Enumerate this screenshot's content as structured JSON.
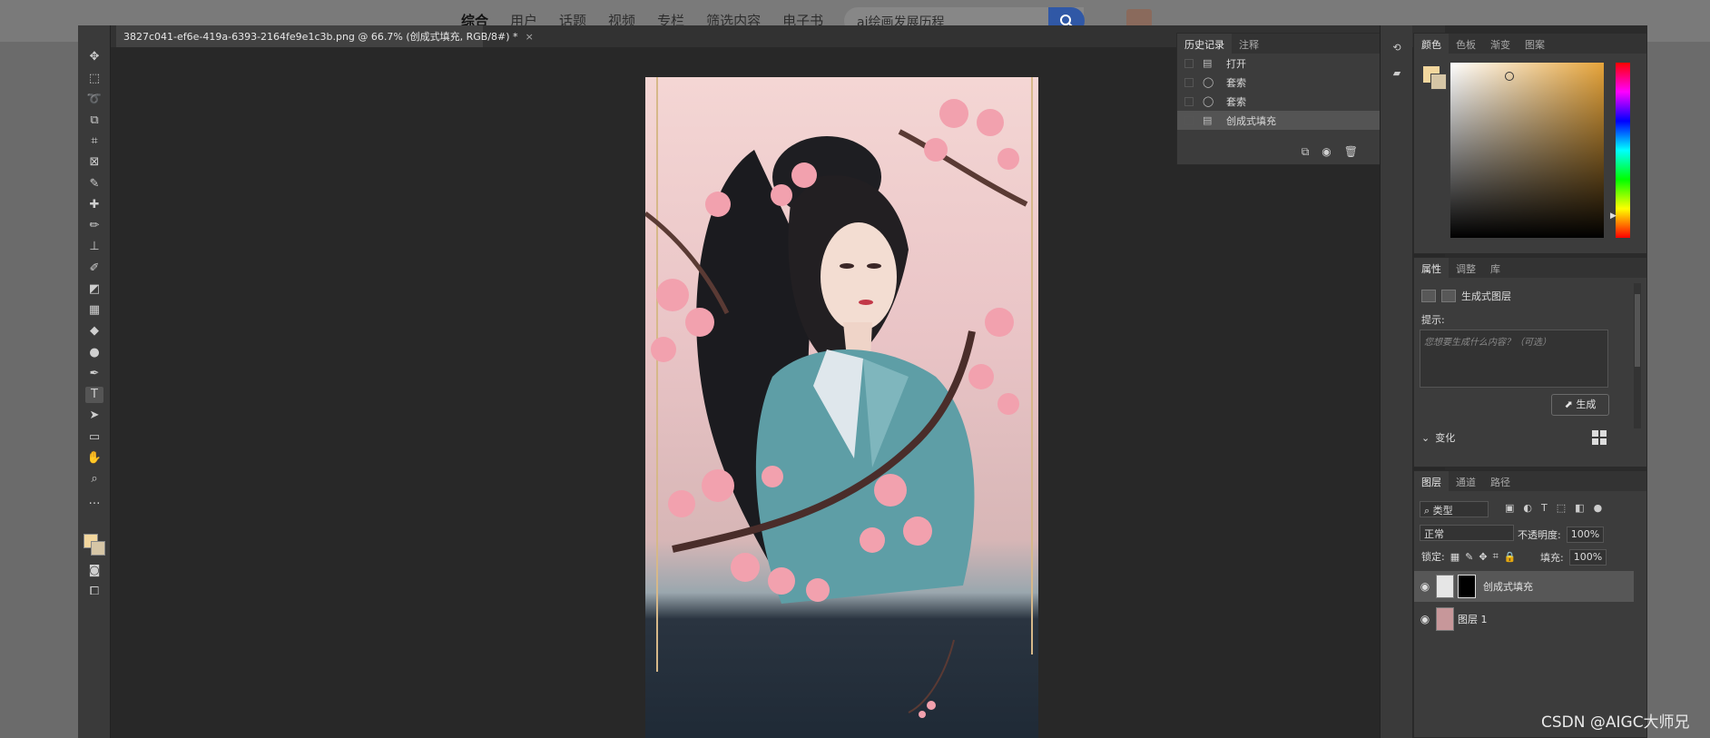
{
  "site": {
    "nav": [
      "综合",
      "用户",
      "话题",
      "视频",
      "专栏",
      "筛选内容",
      "电子书"
    ],
    "search_value": "ai绘画发展历程"
  },
  "document": {
    "tab_title": "3827c041-ef6e-419a-6393-2164fe9e1c3b.png @ 66.7% (创成式填充, RGB/8#) *",
    "close_glyph": "×"
  },
  "history": {
    "tabs": [
      "历史记录",
      "注释"
    ],
    "items": [
      {
        "label": "打开",
        "icon": "document-icon"
      },
      {
        "label": "套索",
        "icon": "lasso-icon"
      },
      {
        "label": "套索",
        "icon": "lasso-icon"
      },
      {
        "label": "创成式填充",
        "icon": "document-icon",
        "current": true
      }
    ]
  },
  "color_panel": {
    "tabs": [
      "颜色",
      "色板",
      "渐变",
      "图案"
    ],
    "foreground": "#f3d79e",
    "background": "#d6c6a6"
  },
  "properties": {
    "tabs": [
      "属性",
      "调整",
      "库"
    ],
    "layer_type": "生成式图层",
    "prompt_label": "提示:",
    "prompt_placeholder": "您想要生成什么内容？（可选）",
    "generate_label": "生成",
    "variations_label": "变化"
  },
  "layers": {
    "tabs": [
      "图层",
      "通道",
      "路径"
    ],
    "filter_label": "类型",
    "blend_mode": "正常",
    "opacity_label": "不透明度:",
    "opacity_value": "100%",
    "lock_label": "锁定:",
    "fill_label": "填充:",
    "fill_value": "100%",
    "items": [
      {
        "name": "创成式填充",
        "selected": true
      },
      {
        "name": "图层 1",
        "selected": false
      }
    ]
  },
  "watermark": "CSDN @AIGC大师兄"
}
